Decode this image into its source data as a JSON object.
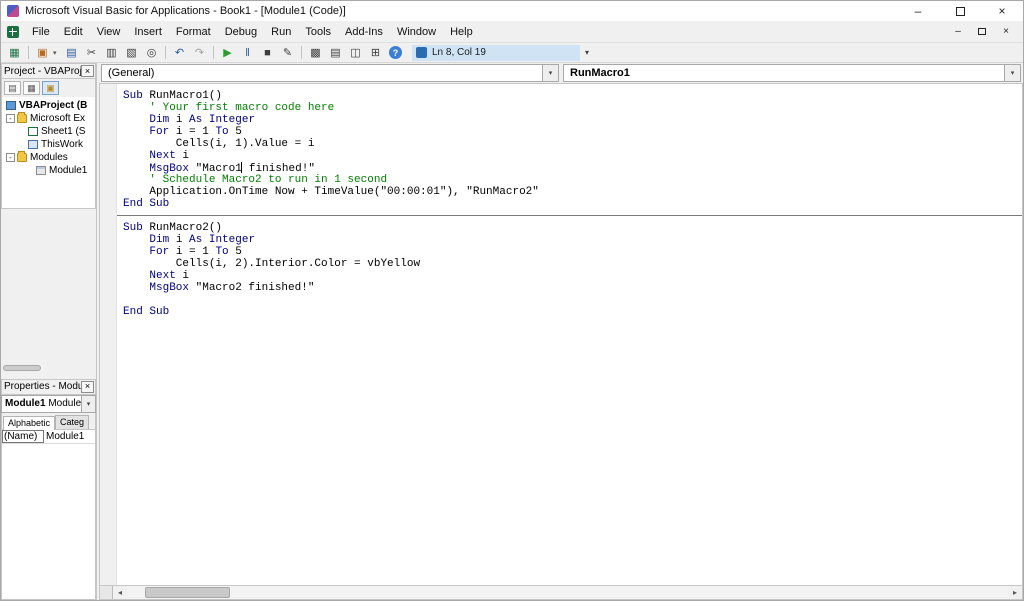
{
  "window": {
    "title": "Microsoft Visual Basic for Applications - Book1 - [Module1 (Code)]"
  },
  "icons": {
    "minimize": "–",
    "close": "×",
    "dropdown": "▾",
    "overflow": "▾",
    "collapse": "-",
    "scroll_left": "◂",
    "scroll_right": "▸"
  },
  "colors": {
    "keyword_blue": "#00007f",
    "comment_green": "#007f00",
    "status_highlight": "#cfe3f5",
    "run_green": "#2d9b2d"
  },
  "menu": {
    "items": [
      "File",
      "Edit",
      "View",
      "Insert",
      "Format",
      "Debug",
      "Run",
      "Tools",
      "Add-Ins",
      "Window",
      "Help"
    ]
  },
  "toolbar": {
    "icons": [
      {
        "name": "view-microsoft-excel",
        "glyph": "▦"
      },
      {
        "name": "insert-userform",
        "glyph": "▣"
      },
      {
        "name": "save",
        "glyph": "▤"
      },
      {
        "name": "cut",
        "glyph": "✂"
      },
      {
        "name": "copy",
        "glyph": "▥"
      },
      {
        "name": "paste",
        "glyph": "▧"
      },
      {
        "name": "find",
        "glyph": "◎"
      },
      {
        "name": "undo",
        "glyph": "↶"
      },
      {
        "name": "redo",
        "glyph": "↷"
      },
      {
        "name": "run-sub",
        "glyph": "▶"
      },
      {
        "name": "break",
        "glyph": "‖"
      },
      {
        "name": "reset",
        "glyph": "■"
      },
      {
        "name": "design-mode",
        "glyph": "✎"
      },
      {
        "name": "project-explorer",
        "glyph": "▩"
      },
      {
        "name": "properties-window",
        "glyph": "▤"
      },
      {
        "name": "object-browser",
        "glyph": "◫"
      },
      {
        "name": "toolbox",
        "glyph": "⊞"
      },
      {
        "name": "help",
        "glyph": "?"
      }
    ],
    "position_status": "Ln 8, Col 19"
  },
  "project_explorer": {
    "title": "Project - VBAProje",
    "buttons": [
      {
        "name": "view-code",
        "glyph": "▤"
      },
      {
        "name": "view-object",
        "glyph": "▦"
      },
      {
        "name": "toggle-folders",
        "glyph": "▣"
      }
    ],
    "items": [
      {
        "label": "VBAProject (B"
      },
      {
        "label": "Microsoft Ex"
      },
      {
        "label": "Sheet1 (S"
      },
      {
        "label": "ThisWork"
      },
      {
        "label": "Modules"
      },
      {
        "label": "Module1"
      }
    ]
  },
  "properties": {
    "title": "Properties - Modu",
    "object_name": "Module1",
    "object_type": "Module",
    "tab_alphabetic": "Alphabetic",
    "tab_categorized": "Categ",
    "rows": [
      {
        "name": "(Name)",
        "value": "Module1"
      }
    ]
  },
  "code_window": {
    "object_box": "(General)",
    "procedure_box": "RunMacro1",
    "lines": [
      {
        "type": "code",
        "segs": [
          {
            "c": "kw",
            "t": "Sub"
          },
          {
            "c": "pl",
            "t": " RunMacro1()"
          }
        ]
      },
      {
        "type": "code",
        "segs": [
          {
            "c": "cm",
            "t": "    ' Your first macro code here"
          }
        ]
      },
      {
        "type": "code",
        "segs": [
          {
            "c": "pl",
            "t": "    "
          },
          {
            "c": "kw",
            "t": "Dim"
          },
          {
            "c": "pl",
            "t": " i "
          },
          {
            "c": "kw",
            "t": "As"
          },
          {
            "c": "pl",
            "t": " "
          },
          {
            "c": "kw",
            "t": "Integer"
          }
        ]
      },
      {
        "type": "code",
        "segs": [
          {
            "c": "pl",
            "t": "    "
          },
          {
            "c": "kw",
            "t": "For"
          },
          {
            "c": "pl",
            "t": " i = 1 "
          },
          {
            "c": "kw",
            "t": "To"
          },
          {
            "c": "pl",
            "t": " 5"
          }
        ]
      },
      {
        "type": "code",
        "segs": [
          {
            "c": "pl",
            "t": "        Cells(i, 1).Value = i"
          }
        ]
      },
      {
        "type": "code",
        "segs": [
          {
            "c": "pl",
            "t": "    "
          },
          {
            "c": "kw",
            "t": "Next"
          },
          {
            "c": "pl",
            "t": " i"
          }
        ]
      },
      {
        "type": "code",
        "segs": [
          {
            "c": "pl",
            "t": "    "
          },
          {
            "c": "kw",
            "t": "MsgBox"
          },
          {
            "c": "pl",
            "t": " \"Macro1"
          },
          {
            "c": "caret",
            "t": ""
          },
          {
            "c": "pl",
            "t": " finished!\""
          }
        ]
      },
      {
        "type": "code",
        "segs": [
          {
            "c": "cm",
            "t": "    ' Schedule Macro2 to run in 1 second"
          }
        ]
      },
      {
        "type": "code",
        "segs": [
          {
            "c": "pl",
            "t": "    Application.OnTime Now + TimeValue(\"00:00:01\"), \"RunMacro2\""
          }
        ]
      },
      {
        "type": "code",
        "segs": [
          {
            "c": "kw",
            "t": "End Sub"
          }
        ]
      },
      {
        "type": "sep"
      },
      {
        "type": "code",
        "segs": [
          {
            "c": "kw",
            "t": "Sub"
          },
          {
            "c": "pl",
            "t": " RunMacro2()"
          }
        ]
      },
      {
        "type": "code",
        "segs": [
          {
            "c": "pl",
            "t": "    "
          },
          {
            "c": "kw",
            "t": "Dim"
          },
          {
            "c": "pl",
            "t": " i "
          },
          {
            "c": "kw",
            "t": "As"
          },
          {
            "c": "pl",
            "t": " "
          },
          {
            "c": "kw",
            "t": "Integer"
          }
        ]
      },
      {
        "type": "code",
        "segs": [
          {
            "c": "pl",
            "t": "    "
          },
          {
            "c": "kw",
            "t": "For"
          },
          {
            "c": "pl",
            "t": " i = 1 "
          },
          {
            "c": "kw",
            "t": "To"
          },
          {
            "c": "pl",
            "t": " 5"
          }
        ]
      },
      {
        "type": "code",
        "segs": [
          {
            "c": "pl",
            "t": "        Cells(i, 2).Interior.Color = vbYellow"
          }
        ]
      },
      {
        "type": "code",
        "segs": [
          {
            "c": "pl",
            "t": "    "
          },
          {
            "c": "kw",
            "t": "Next"
          },
          {
            "c": "pl",
            "t": " i"
          }
        ]
      },
      {
        "type": "code",
        "segs": [
          {
            "c": "pl",
            "t": "    "
          },
          {
            "c": "kw",
            "t": "MsgBox"
          },
          {
            "c": "pl",
            "t": " \"Macro2 finished!\""
          }
        ]
      },
      {
        "type": "blank"
      },
      {
        "type": "code",
        "segs": [
          {
            "c": "kw",
            "t": "End Sub"
          }
        ]
      }
    ]
  }
}
